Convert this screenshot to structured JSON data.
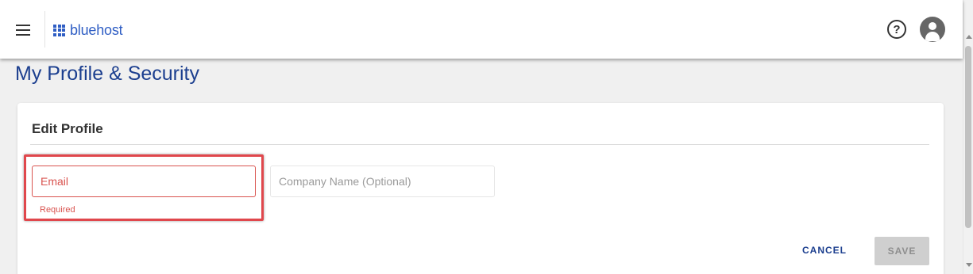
{
  "header": {
    "menu_icon": "hamburger-menu-icon",
    "logo_text": "bluehost",
    "logo_icon": "grid-logo-icon",
    "help_icon_glyph": "?",
    "help_icon": "help-circle-icon",
    "avatar_icon": "account-avatar-icon"
  },
  "page": {
    "title": "My Profile & Security"
  },
  "card": {
    "title": "Edit Profile",
    "email": {
      "placeholder": "Email",
      "value": "",
      "error": "Required"
    },
    "company": {
      "placeholder": "Company Name (Optional)",
      "value": ""
    },
    "cancel_label": "CANCEL",
    "save_label": "SAVE"
  },
  "colors": {
    "brand_blue": "#2f5ec4",
    "title_blue": "#1c3f8f",
    "error_red": "#d9534f",
    "highlight_red": "#e0474c",
    "disabled_gray": "#cfcfcf"
  }
}
